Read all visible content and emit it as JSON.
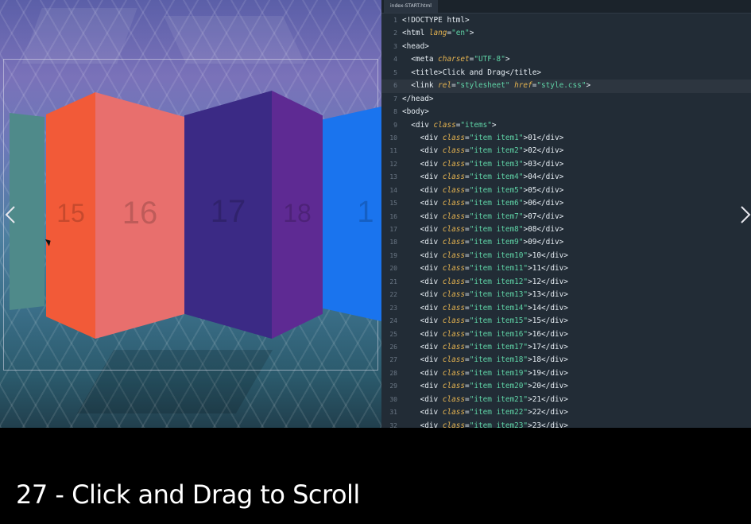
{
  "preview": {
    "panels": [
      {
        "label": "",
        "color": "#4f8a8a"
      },
      {
        "label": "15",
        "color": "#f25a38"
      },
      {
        "label": "16",
        "color": "#e86f6d"
      },
      {
        "label": "17",
        "color": "#3b2a85"
      },
      {
        "label": "18",
        "color": "#5e2a93"
      },
      {
        "label": "1",
        "color": "#1a74ee"
      }
    ]
  },
  "editor": {
    "tab_label": "index-START.html",
    "lines": [
      {
        "n": "1",
        "parts": [
          [
            "tag",
            "<!DOCTYPE html>"
          ]
        ]
      },
      {
        "n": "2",
        "parts": [
          [
            "tag",
            "<html "
          ],
          [
            "attr",
            "lang"
          ],
          [
            "tag",
            "="
          ],
          [
            "str",
            "\"en\""
          ],
          [
            "tag",
            ">"
          ]
        ]
      },
      {
        "n": "3",
        "parts": [
          [
            "tag",
            "<head>"
          ]
        ]
      },
      {
        "n": "4",
        "parts": [
          [
            "tag",
            "  <meta "
          ],
          [
            "attr",
            "charset"
          ],
          [
            "tag",
            "="
          ],
          [
            "str",
            "\"UTF-8\""
          ],
          [
            "tag",
            ">"
          ]
        ]
      },
      {
        "n": "5",
        "parts": [
          [
            "tag",
            "  <title>"
          ],
          [
            "txt",
            "Click and Drag"
          ],
          [
            "tag",
            "</title>"
          ]
        ]
      },
      {
        "n": "6",
        "parts": [
          [
            "tag",
            "  <link "
          ],
          [
            "attr",
            "rel"
          ],
          [
            "tag",
            "="
          ],
          [
            "str",
            "\"stylesheet\""
          ],
          [
            "tag",
            " "
          ],
          [
            "attr",
            "href"
          ],
          [
            "tag",
            "="
          ],
          [
            "str",
            "\"style.css\""
          ],
          [
            "tag",
            ">"
          ]
        ]
      },
      {
        "n": "7",
        "parts": [
          [
            "tag",
            "</head>"
          ]
        ]
      },
      {
        "n": "8",
        "parts": [
          [
            "tag",
            "<body>"
          ]
        ]
      },
      {
        "n": "9",
        "parts": [
          [
            "tag",
            "  <div "
          ],
          [
            "attr",
            "class"
          ],
          [
            "tag",
            "="
          ],
          [
            "str",
            "\"items\""
          ],
          [
            "tag",
            ">"
          ]
        ]
      },
      {
        "n": "10",
        "parts": [
          [
            "tag",
            "    <div "
          ],
          [
            "attr",
            "class"
          ],
          [
            "tag",
            "="
          ],
          [
            "str",
            "\"item item1\""
          ],
          [
            "tag",
            ">"
          ],
          [
            "txt",
            "01"
          ],
          [
            "tag",
            "</div>"
          ]
        ]
      },
      {
        "n": "11",
        "parts": [
          [
            "tag",
            "    <div "
          ],
          [
            "attr",
            "class"
          ],
          [
            "tag",
            "="
          ],
          [
            "str",
            "\"item item2\""
          ],
          [
            "tag",
            ">"
          ],
          [
            "txt",
            "02"
          ],
          [
            "tag",
            "</div>"
          ]
        ]
      },
      {
        "n": "12",
        "parts": [
          [
            "tag",
            "    <div "
          ],
          [
            "attr",
            "class"
          ],
          [
            "tag",
            "="
          ],
          [
            "str",
            "\"item item3\""
          ],
          [
            "tag",
            ">"
          ],
          [
            "txt",
            "03"
          ],
          [
            "tag",
            "</div>"
          ]
        ]
      },
      {
        "n": "13",
        "parts": [
          [
            "tag",
            "    <div "
          ],
          [
            "attr",
            "class"
          ],
          [
            "tag",
            "="
          ],
          [
            "str",
            "\"item item4\""
          ],
          [
            "tag",
            ">"
          ],
          [
            "txt",
            "04"
          ],
          [
            "tag",
            "</div>"
          ]
        ]
      },
      {
        "n": "14",
        "parts": [
          [
            "tag",
            "    <div "
          ],
          [
            "attr",
            "class"
          ],
          [
            "tag",
            "="
          ],
          [
            "str",
            "\"item item5\""
          ],
          [
            "tag",
            ">"
          ],
          [
            "txt",
            "05"
          ],
          [
            "tag",
            "</div>"
          ]
        ]
      },
      {
        "n": "15",
        "parts": [
          [
            "tag",
            "    <div "
          ],
          [
            "attr",
            "class"
          ],
          [
            "tag",
            "="
          ],
          [
            "str",
            "\"item item6\""
          ],
          [
            "tag",
            ">"
          ],
          [
            "txt",
            "06"
          ],
          [
            "tag",
            "</div>"
          ]
        ]
      },
      {
        "n": "16",
        "parts": [
          [
            "tag",
            "    <div "
          ],
          [
            "attr",
            "class"
          ],
          [
            "tag",
            "="
          ],
          [
            "str",
            "\"item item7\""
          ],
          [
            "tag",
            ">"
          ],
          [
            "txt",
            "07"
          ],
          [
            "tag",
            "</div>"
          ]
        ]
      },
      {
        "n": "17",
        "parts": [
          [
            "tag",
            "    <div "
          ],
          [
            "attr",
            "class"
          ],
          [
            "tag",
            "="
          ],
          [
            "str",
            "\"item item8\""
          ],
          [
            "tag",
            ">"
          ],
          [
            "txt",
            "08"
          ],
          [
            "tag",
            "</div>"
          ]
        ]
      },
      {
        "n": "18",
        "parts": [
          [
            "tag",
            "    <div "
          ],
          [
            "attr",
            "class"
          ],
          [
            "tag",
            "="
          ],
          [
            "str",
            "\"item item9\""
          ],
          [
            "tag",
            ">"
          ],
          [
            "txt",
            "09"
          ],
          [
            "tag",
            "</div>"
          ]
        ]
      },
      {
        "n": "19",
        "parts": [
          [
            "tag",
            "    <div "
          ],
          [
            "attr",
            "class"
          ],
          [
            "tag",
            "="
          ],
          [
            "str",
            "\"item item10\""
          ],
          [
            "tag",
            ">"
          ],
          [
            "txt",
            "10"
          ],
          [
            "tag",
            "</div>"
          ]
        ]
      },
      {
        "n": "20",
        "parts": [
          [
            "tag",
            "    <div "
          ],
          [
            "attr",
            "class"
          ],
          [
            "tag",
            "="
          ],
          [
            "str",
            "\"item item11\""
          ],
          [
            "tag",
            ">"
          ],
          [
            "txt",
            "11"
          ],
          [
            "tag",
            "</div>"
          ]
        ]
      },
      {
        "n": "21",
        "parts": [
          [
            "tag",
            "    <div "
          ],
          [
            "attr",
            "class"
          ],
          [
            "tag",
            "="
          ],
          [
            "str",
            "\"item item12\""
          ],
          [
            "tag",
            ">"
          ],
          [
            "txt",
            "12"
          ],
          [
            "tag",
            "</div>"
          ]
        ]
      },
      {
        "n": "22",
        "parts": [
          [
            "tag",
            "    <div "
          ],
          [
            "attr",
            "class"
          ],
          [
            "tag",
            "="
          ],
          [
            "str",
            "\"item item13\""
          ],
          [
            "tag",
            ">"
          ],
          [
            "txt",
            "13"
          ],
          [
            "tag",
            "</div>"
          ]
        ]
      },
      {
        "n": "23",
        "parts": [
          [
            "tag",
            "    <div "
          ],
          [
            "attr",
            "class"
          ],
          [
            "tag",
            "="
          ],
          [
            "str",
            "\"item item14\""
          ],
          [
            "tag",
            ">"
          ],
          [
            "txt",
            "14"
          ],
          [
            "tag",
            "</div>"
          ]
        ]
      },
      {
        "n": "24",
        "parts": [
          [
            "tag",
            "    <div "
          ],
          [
            "attr",
            "class"
          ],
          [
            "tag",
            "="
          ],
          [
            "str",
            "\"item item15\""
          ],
          [
            "tag",
            ">"
          ],
          [
            "txt",
            "15"
          ],
          [
            "tag",
            "</div>"
          ]
        ]
      },
      {
        "n": "25",
        "parts": [
          [
            "tag",
            "    <div "
          ],
          [
            "attr",
            "class"
          ],
          [
            "tag",
            "="
          ],
          [
            "str",
            "\"item item16\""
          ],
          [
            "tag",
            ">"
          ],
          [
            "txt",
            "16"
          ],
          [
            "tag",
            "</div>"
          ]
        ]
      },
      {
        "n": "26",
        "parts": [
          [
            "tag",
            "    <div "
          ],
          [
            "attr",
            "class"
          ],
          [
            "tag",
            "="
          ],
          [
            "str",
            "\"item item17\""
          ],
          [
            "tag",
            ">"
          ],
          [
            "txt",
            "17"
          ],
          [
            "tag",
            "</div>"
          ]
        ]
      },
      {
        "n": "27",
        "parts": [
          [
            "tag",
            "    <div "
          ],
          [
            "attr",
            "class"
          ],
          [
            "tag",
            "="
          ],
          [
            "str",
            "\"item item18\""
          ],
          [
            "tag",
            ">"
          ],
          [
            "txt",
            "18"
          ],
          [
            "tag",
            "</div>"
          ]
        ]
      },
      {
        "n": "28",
        "parts": [
          [
            "tag",
            "    <div "
          ],
          [
            "attr",
            "class"
          ],
          [
            "tag",
            "="
          ],
          [
            "str",
            "\"item item19\""
          ],
          [
            "tag",
            ">"
          ],
          [
            "txt",
            "19"
          ],
          [
            "tag",
            "</div>"
          ]
        ]
      },
      {
        "n": "29",
        "parts": [
          [
            "tag",
            "    <div "
          ],
          [
            "attr",
            "class"
          ],
          [
            "tag",
            "="
          ],
          [
            "str",
            "\"item item20\""
          ],
          [
            "tag",
            ">"
          ],
          [
            "txt",
            "20"
          ],
          [
            "tag",
            "</div>"
          ]
        ]
      },
      {
        "n": "30",
        "parts": [
          [
            "tag",
            "    <div "
          ],
          [
            "attr",
            "class"
          ],
          [
            "tag",
            "="
          ],
          [
            "str",
            "\"item item21\""
          ],
          [
            "tag",
            ">"
          ],
          [
            "txt",
            "21"
          ],
          [
            "tag",
            "</div>"
          ]
        ]
      },
      {
        "n": "31",
        "parts": [
          [
            "tag",
            "    <div "
          ],
          [
            "attr",
            "class"
          ],
          [
            "tag",
            "="
          ],
          [
            "str",
            "\"item item22\""
          ],
          [
            "tag",
            ">"
          ],
          [
            "txt",
            "22"
          ],
          [
            "tag",
            "</div>"
          ]
        ]
      },
      {
        "n": "32",
        "parts": [
          [
            "tag",
            "    <div "
          ],
          [
            "attr",
            "class"
          ],
          [
            "tag",
            "="
          ],
          [
            "str",
            "\"item item23\""
          ],
          [
            "tag",
            ">"
          ],
          [
            "txt",
            "23"
          ],
          [
            "tag",
            "</div>"
          ]
        ]
      }
    ]
  },
  "caption": "27 - Click and Drag to Scroll",
  "icons": {
    "prev": "chevron-left-icon",
    "next": "chevron-right-icon"
  }
}
